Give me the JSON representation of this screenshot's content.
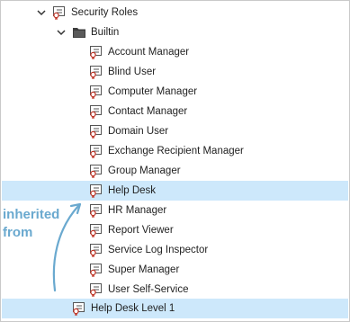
{
  "tree": {
    "root": {
      "label": "Security Roles",
      "expanded": true
    },
    "folder": {
      "label": "Builtin",
      "expanded": true
    },
    "items": [
      {
        "label": "Account Manager"
      },
      {
        "label": "Blind User"
      },
      {
        "label": "Computer Manager"
      },
      {
        "label": "Contact Manager"
      },
      {
        "label": "Domain User"
      },
      {
        "label": "Exchange Recipient Manager"
      },
      {
        "label": "Group Manager"
      },
      {
        "label": "Help Desk",
        "selected": true
      },
      {
        "label": "HR Manager"
      },
      {
        "label": "Report Viewer"
      },
      {
        "label": "Service Log Inspector"
      },
      {
        "label": "Super Manager"
      },
      {
        "label": "User Self-Service"
      }
    ],
    "bottom_item": {
      "label": "Help Desk Level 1",
      "selected": true
    }
  },
  "annotation": {
    "line1": "inherited",
    "line2": "from",
    "color": "#6aa9cf"
  },
  "colors": {
    "selection": "#cde8fb",
    "role_icon": "#c0392b",
    "folder_icon": "#3a3a3a"
  }
}
